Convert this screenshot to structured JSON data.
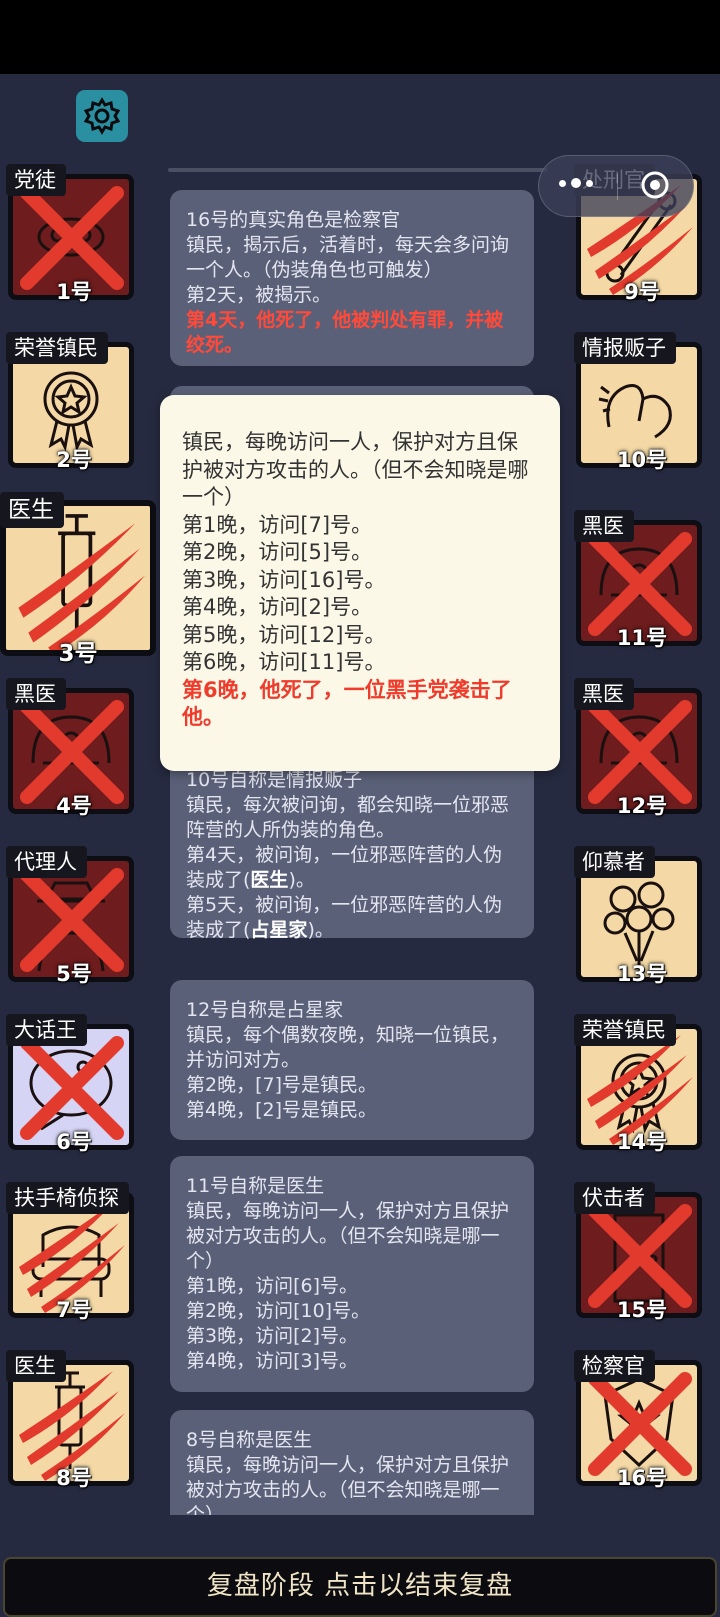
{
  "colors": {
    "panel": "#262a40",
    "good_tile": "#f4d9a6",
    "evil_tile": "#6e1c1d",
    "lilac_tile": "#d5d4f4",
    "claw": "#e23a2c",
    "accent": "#2a8fa0"
  },
  "icons": {
    "settings": "gear-icon",
    "capsule_more": "more-dots-icon",
    "capsule_close": "record-close-icon"
  },
  "players": {
    "p1": {
      "role": "党徒",
      "num": "1号",
      "status": "x",
      "art": "mask-icon"
    },
    "p2": {
      "role": "荣誉镇民",
      "num": "2号",
      "status": "alive",
      "art": "medal-icon"
    },
    "p3": {
      "role": "医生",
      "num": "3号",
      "status": "claw",
      "art": "syringe-icon"
    },
    "p4": {
      "role": "黑医",
      "num": "4号",
      "status": "x",
      "art": "dark-doctor-icon"
    },
    "p5": {
      "role": "代理人",
      "num": "5号",
      "status": "x",
      "art": "hooded-agent-icon"
    },
    "p6": {
      "role": "大话王",
      "num": "6号",
      "status": "x",
      "art": "bubble-icon"
    },
    "p7": {
      "role": "扶手椅侦探",
      "num": "7号",
      "status": "claw",
      "art": "armchair-icon"
    },
    "p8": {
      "role": "医生",
      "num": "8号",
      "status": "claw",
      "art": "syringe-icon"
    },
    "p9": {
      "role": "处刑官",
      "num": "9号",
      "status": "claw",
      "art": "scroll-icon"
    },
    "p10": {
      "role": "情报贩子",
      "num": "10号",
      "status": "alive",
      "art": "whisper-icon"
    },
    "p11": {
      "role": "黑医",
      "num": "11号",
      "status": "x",
      "art": "dark-doctor-icon"
    },
    "p12": {
      "role": "黑医",
      "num": "12号",
      "status": "x",
      "art": "dark-doctor-icon"
    },
    "p13": {
      "role": "仰慕者",
      "num": "13号",
      "status": "alive",
      "art": "roses-icon"
    },
    "p14": {
      "role": "荣誉镇民",
      "num": "14号",
      "status": "claw",
      "art": "medal-icon"
    },
    "p15": {
      "role": "伏击者",
      "num": "15号",
      "status": "x",
      "art": "door-icon"
    },
    "p16": {
      "role": "检察官",
      "num": "16号",
      "status": "x",
      "art": "badge-icon"
    }
  },
  "log": {
    "card1": {
      "l1": "16号的真实角色是检察官",
      "l2": "镇民，揭示后，活着时，每天会多问询一个人。（伪装角色也可触发）",
      "l3": "第2天，被揭示。",
      "l4": "第4天，他死了，他被判处有罪，并被绞死。"
    },
    "card3": {
      "l1": "10号自称是情报贩子",
      "l2": "镇民，每次被问询，都会知晓一位邪恶阵营的人所伪装的角色。",
      "l3a": "第4天，被问询，一位邪恶阵营的人伪装成了(",
      "l3b": "医生",
      "l3c": ")。",
      "l4a": "第5天，被问询，一位邪恶阵营的人伪装成了(",
      "l4b": "占星家",
      "l4c": ")。"
    },
    "card4": {
      "l1": "12号自称是占星家",
      "l2": "镇民，每个偶数夜晚，知晓一位镇民，并访问对方。",
      "l3": "第2晚，[7]号是镇民。",
      "l4": "第4晚，[2]号是镇民。"
    },
    "card5": {
      "l1": "11号自称是医生",
      "l2": "镇民，每晚访问一人，保护对方且保护被对方攻击的人。（但不会知晓是哪一个）",
      "l3": "第1晚，访问[6]号。",
      "l4": "第2晚，访问[10]号。",
      "l5": "第3晚，访问[2]号。",
      "l6": "第4晚，访问[3]号。"
    },
    "card6": {
      "l1": "8号自称是医生",
      "l2": "镇民，每晚访问一人，保护对方且保护被对方攻击的人。（但不会知晓是哪一个）"
    }
  },
  "popup": {
    "desc": "镇民，每晚访问一人，保护对方且保护被对方攻击的人。（但不会知晓是哪一个）",
    "n1": "第1晚，访问[7]号。",
    "n2": "第2晚，访问[5]号。",
    "n3": "第3晚，访问[16]号。",
    "n4": "第4晚，访问[2]号。",
    "n5": "第5晚，访问[12]号。",
    "n6": "第6晚，访问[11]号。",
    "death": "第6晚，他死了，一位黑手党袭击了他。"
  },
  "bottom": {
    "label": "复盘阶段 点击以结束复盘"
  }
}
